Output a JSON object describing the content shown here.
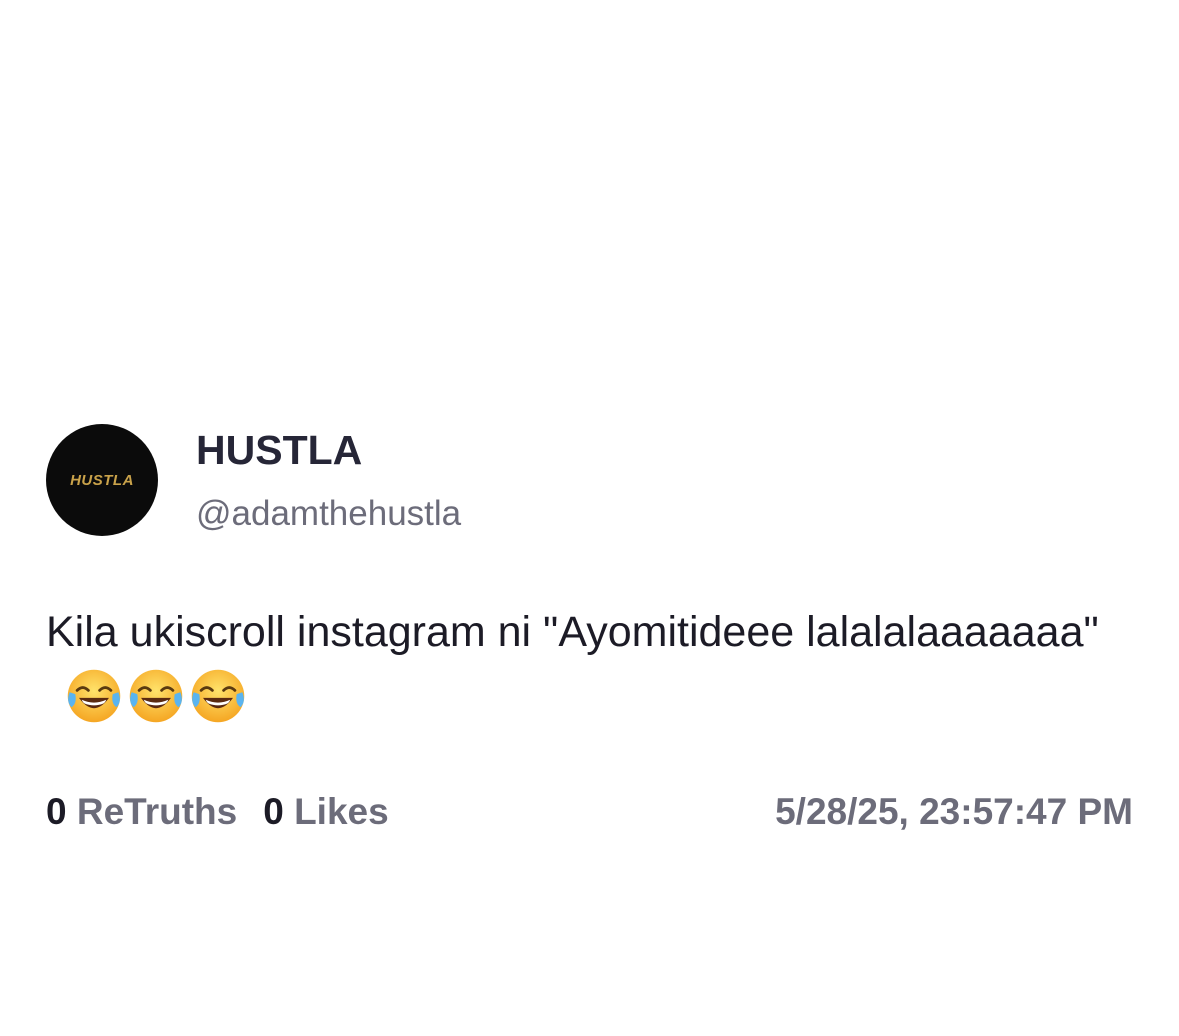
{
  "post": {
    "avatar_text": "HUSTLA",
    "display_name": "HUSTLA",
    "handle": "@adamthehustla",
    "body_text": "Kila ukiscroll instagram ni \"Ayomitideee lalalalaaaaaaa\"",
    "emojis": [
      "face-with-tears-of-joy-icon",
      "face-with-tears-of-joy-icon",
      "face-with-tears-of-joy-icon"
    ],
    "retruths_count": "0",
    "retruths_label": "ReTruths",
    "likes_count": "0",
    "likes_label": "Likes",
    "timestamp": "5/28/25, 23:57:47 PM"
  },
  "colors": {
    "avatar_bg": "#0b0b0b",
    "avatar_text": "#c9a24a",
    "name": "#262637",
    "muted": "#6c6c7a",
    "body": "#1c1b26"
  }
}
